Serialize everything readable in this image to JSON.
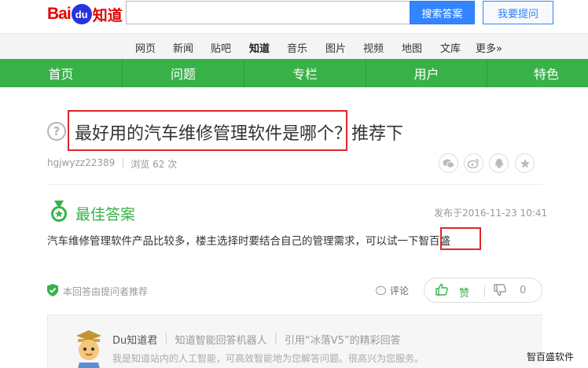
{
  "logo": {
    "bai": "Bai",
    "du": "du",
    "zhidao": "知道"
  },
  "search": {
    "placeholder": "",
    "search_button": "搜索答案",
    "ask_button": "我要提问"
  },
  "channel_nav": [
    "网页",
    "新闻",
    "贴吧",
    "知道",
    "音乐",
    "图片",
    "视频",
    "地图",
    "文库",
    "更多»"
  ],
  "green_nav": [
    "首页",
    "问题",
    "专栏",
    "用户",
    "特色"
  ],
  "question": {
    "icon": "?",
    "title": "最好用的汽车维修管理软件是哪个？推荐下",
    "asker": "hgjwyzz22389",
    "views": "浏览 62 次"
  },
  "share_icons": [
    "wechat-icon",
    "weibo-icon",
    "qq-icon",
    "favorite-icon"
  ],
  "answer": {
    "label": "最佳答案",
    "post_time": "发布于2016-11-23 10:41",
    "text": "汽车维修管理软件产品比较多，楼主选择时要结合自己的管理需求，可以试一下智百盛",
    "recommended": "本回答由提问者推荐",
    "comment": "评论",
    "like_label": "赞",
    "dislike_count": "0"
  },
  "robot": {
    "name": "Du知道君",
    "tag1": "知道智能回答机器人",
    "tag2": "引用“冰落V5”的精彩回答",
    "desc": "我是知道站内的人工智能，可高效智能地为您解答问题。很高兴为您服务。"
  },
  "watermark": "智百盛软件",
  "colors": {
    "green": "#38b248",
    "blue": "#3385ff",
    "red_highlight": "#e0252b",
    "baidu_red": "#e10602"
  }
}
